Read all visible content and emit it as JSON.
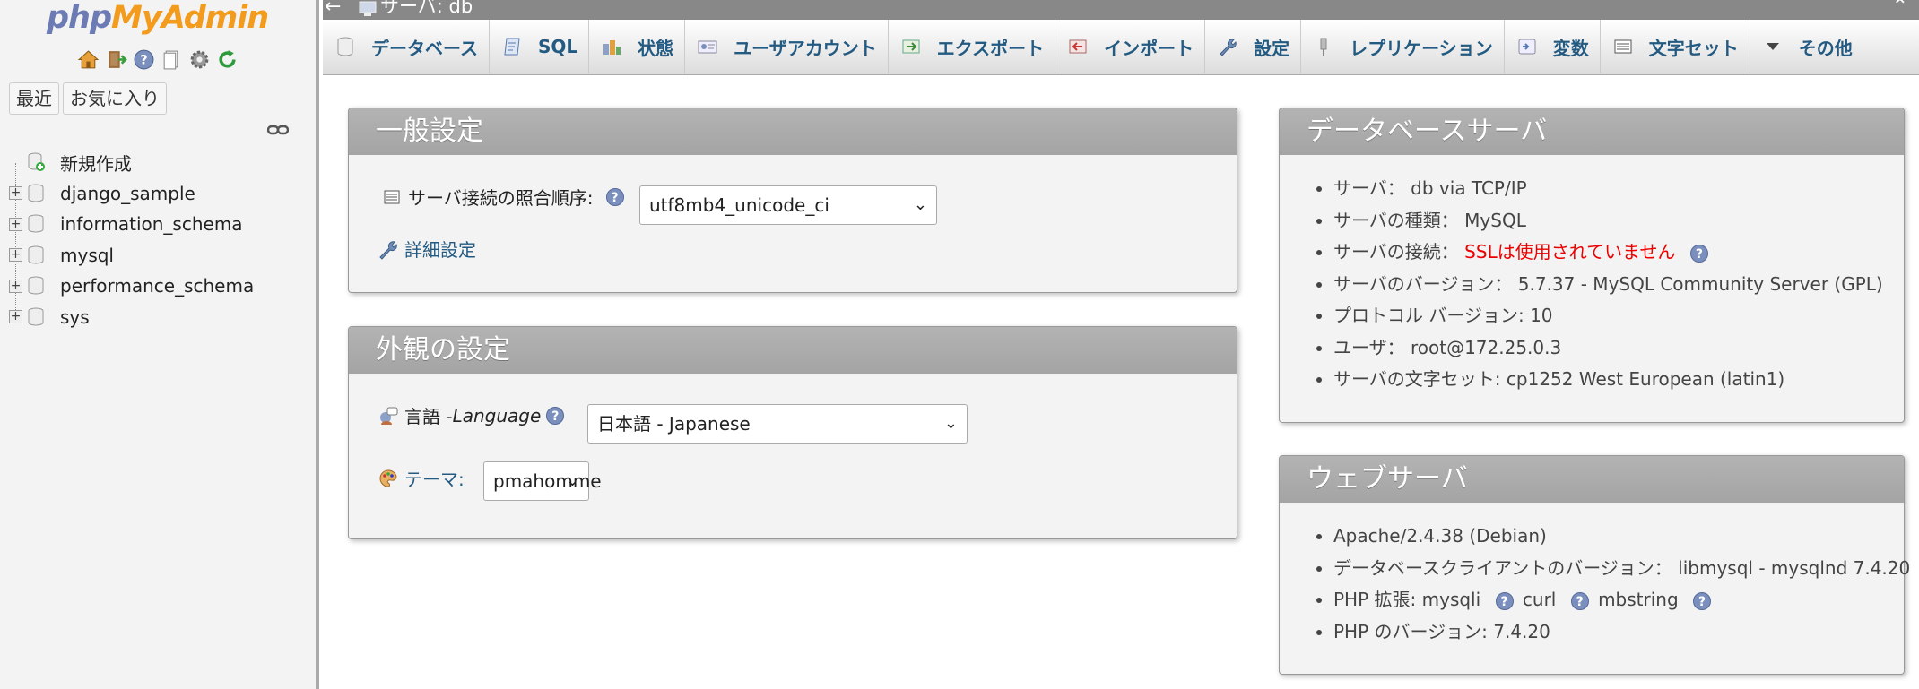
{
  "nav": {
    "logo": {
      "php": "php",
      "my": "My",
      "admin": "Admin"
    },
    "icons": [
      "home-icon",
      "logout-icon",
      "help-icon",
      "docs-icon",
      "settings-icon",
      "reload-icon"
    ],
    "tabs": [
      "最近",
      "お気に入り"
    ],
    "tree": [
      {
        "label": "新規作成",
        "expandable": false
      },
      {
        "label": "django_sample",
        "expandable": true
      },
      {
        "label": "information_schema",
        "expandable": true
      },
      {
        "label": "mysql",
        "expandable": true
      },
      {
        "label": "performance_schema",
        "expandable": true
      },
      {
        "label": "sys",
        "expandable": true
      }
    ]
  },
  "titlebar": {
    "back": "←",
    "crumb": "サーバ: db",
    "collapse": "⌃"
  },
  "menubar": {
    "tabs": [
      {
        "label": "データベース",
        "icon": "database-icon"
      },
      {
        "label": "SQL",
        "icon": "sql-icon"
      },
      {
        "label": "状態",
        "icon": "status-icon"
      },
      {
        "label": "ユーザアカウント",
        "icon": "user-accounts-icon"
      },
      {
        "label": "エクスポート",
        "icon": "export-icon"
      },
      {
        "label": "インポート",
        "icon": "import-icon"
      },
      {
        "label": "設定",
        "icon": "wrench-icon"
      },
      {
        "label": "レプリケーション",
        "icon": "replication-icon"
      },
      {
        "label": "変数",
        "icon": "variables-icon"
      },
      {
        "label": "文字セット",
        "icon": "charset-icon"
      },
      {
        "label": "その他",
        "icon": "dropdown-triangle-icon"
      }
    ]
  },
  "general": {
    "title": "一般設定",
    "collation_label": "サーバ接続の照合順序:",
    "collation_value": "utf8mb4_unicode_ci",
    "more_settings": "詳細設定"
  },
  "appearance": {
    "title": "外観の設定",
    "language_label": "言語 - ",
    "language_label_en": "Language",
    "language_value": "日本語 - Japanese",
    "theme_label": "テーマ:",
    "theme_value": "pmahomme"
  },
  "dbserver": {
    "title": "データベースサーバ",
    "items": [
      {
        "label": "サーバ： ",
        "value": "db via TCP/IP"
      },
      {
        "label": "サーバの種類： ",
        "value": "MySQL"
      },
      {
        "label": "サーバの接続： ",
        "value": "SSLは使用されていません"
      },
      {
        "label": "サーバのバージョン： ",
        "value": "5.7.37 - MySQL Community Server (GPL)"
      },
      {
        "label": "プロトコル バージョン: ",
        "value": "10"
      },
      {
        "label": "ユーザ： ",
        "value": "root@172.25.0.3"
      },
      {
        "label": "サーバの文字セット: ",
        "value": "cp1252 West European (latin1)"
      }
    ]
  },
  "webserver": {
    "title": "ウェブサーバ",
    "apache": "Apache/2.4.38 (Debian)",
    "client_label": "データベースクライアントのバージョン： ",
    "client_value": "libmysql - mysqlnd 7.4.20",
    "ext_label": "PHP 拡張: ",
    "ext1": "mysqli",
    "ext2": "curl",
    "ext3": "mbstring",
    "php_label": "PHP のバージョン: ",
    "php_value": "7.4.20"
  },
  "colors": {
    "link": "#235a81",
    "header": "#a8a8a8",
    "warning": "#ee0000"
  }
}
